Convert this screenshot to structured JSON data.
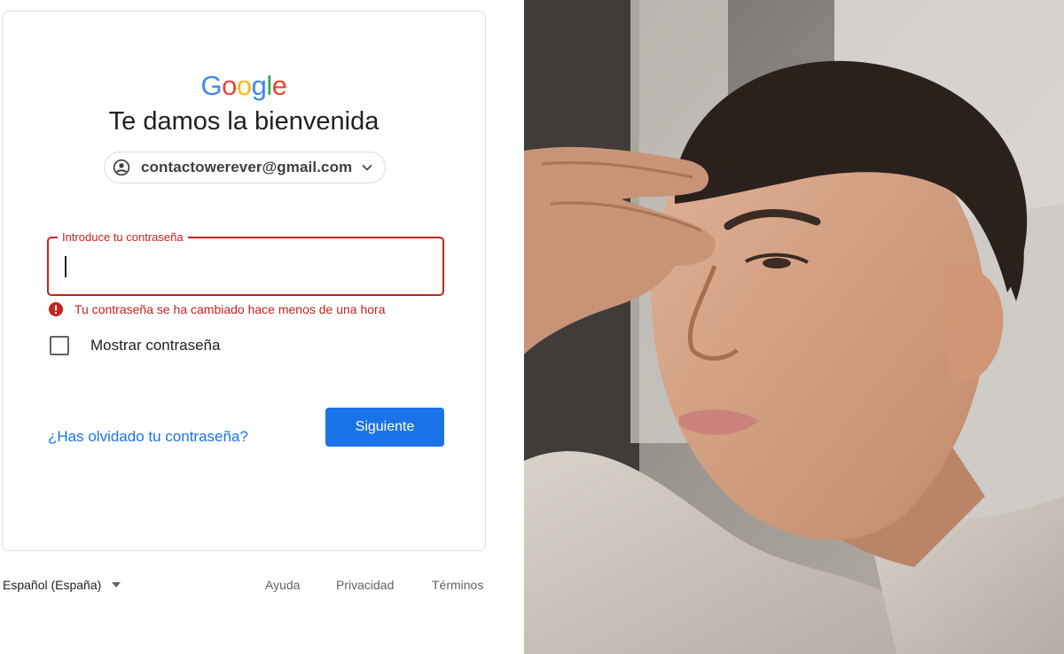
{
  "brand": {
    "logo_letters": [
      "G",
      "o",
      "o",
      "g",
      "l",
      "e"
    ],
    "logo_colors": [
      "#4285F4",
      "#EA4335",
      "#FBBC05",
      "#4285F4",
      "#34A853",
      "#EA4335"
    ]
  },
  "signin": {
    "title": "Te damos la bienvenida",
    "account_email": "contactowerever@gmail.com",
    "password_label": "Introduce tu contraseña",
    "password_value": "",
    "error_message": "Tu contraseña se ha cambiado hace menos de una hora",
    "show_password_label": "Mostrar contraseña",
    "show_password_checked": false,
    "forgot_password_label": "¿Has olvidado tu contraseña?",
    "next_label": "Siguiente"
  },
  "footer": {
    "language": "Español (España)",
    "links": [
      "Ayuda",
      "Privacidad",
      "Términos"
    ]
  },
  "photo": {
    "icon": "selfie-photo",
    "colors": {
      "skin": "#d9a585",
      "hair": "#2a211c",
      "shirt": "#c9c3b8",
      "seat": "#8f8a84"
    }
  },
  "theme": {
    "accent": "#1a73e8",
    "error": "#c5221f",
    "border": "#dadce0"
  }
}
